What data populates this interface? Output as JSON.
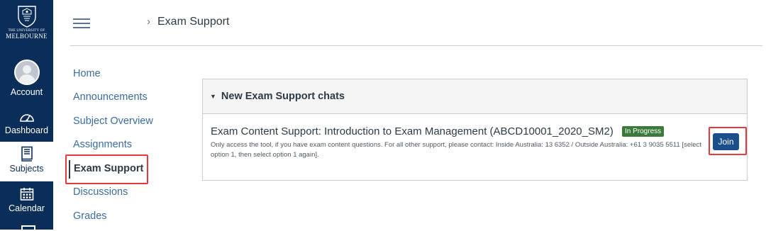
{
  "branding": {
    "logo_line1": "THE UNIVERSITY OF",
    "logo_line2": "MELBOURNE",
    "nav_bg": "#0a2e58"
  },
  "global_nav": {
    "account": {
      "label": "Account",
      "icon": "user-avatar-icon"
    },
    "dashboard": {
      "label": "Dashboard",
      "icon": "speedometer-icon"
    },
    "subjects": {
      "label": "Subjects",
      "icon": "book-icon",
      "active": true
    },
    "calendar": {
      "label": "Calendar",
      "icon": "calendar-icon"
    }
  },
  "header": {
    "menu_icon": "hamburger-icon",
    "separator": "›",
    "breadcrumb": "Exam Support"
  },
  "subject_nav": {
    "items": [
      {
        "label": "Home"
      },
      {
        "label": "Announcements"
      },
      {
        "label": "Subject Overview"
      },
      {
        "label": "Assignments"
      },
      {
        "label": "Exam Support",
        "active": true
      },
      {
        "label": "Discussions"
      },
      {
        "label": "Grades"
      }
    ]
  },
  "panel": {
    "toggle_icon": "caret-down-icon",
    "title": "New Exam Support chats",
    "row": {
      "title": "Exam Content Support: Introduction to Exam Management (ABCD10001_2020_SM2)",
      "status": "In Progress",
      "status_color": "#3b7a3b",
      "desc": "Only access the tool,  if you have exam content questions. For all other support, please contact: Inside Australia: 13 6352 / Outside Australia: +61 3 9035 5511 [select option 1, then select option 1 again].",
      "join_label": "Join",
      "join_color": "#1a4f8b"
    }
  },
  "highlight_color": "#e0393e"
}
